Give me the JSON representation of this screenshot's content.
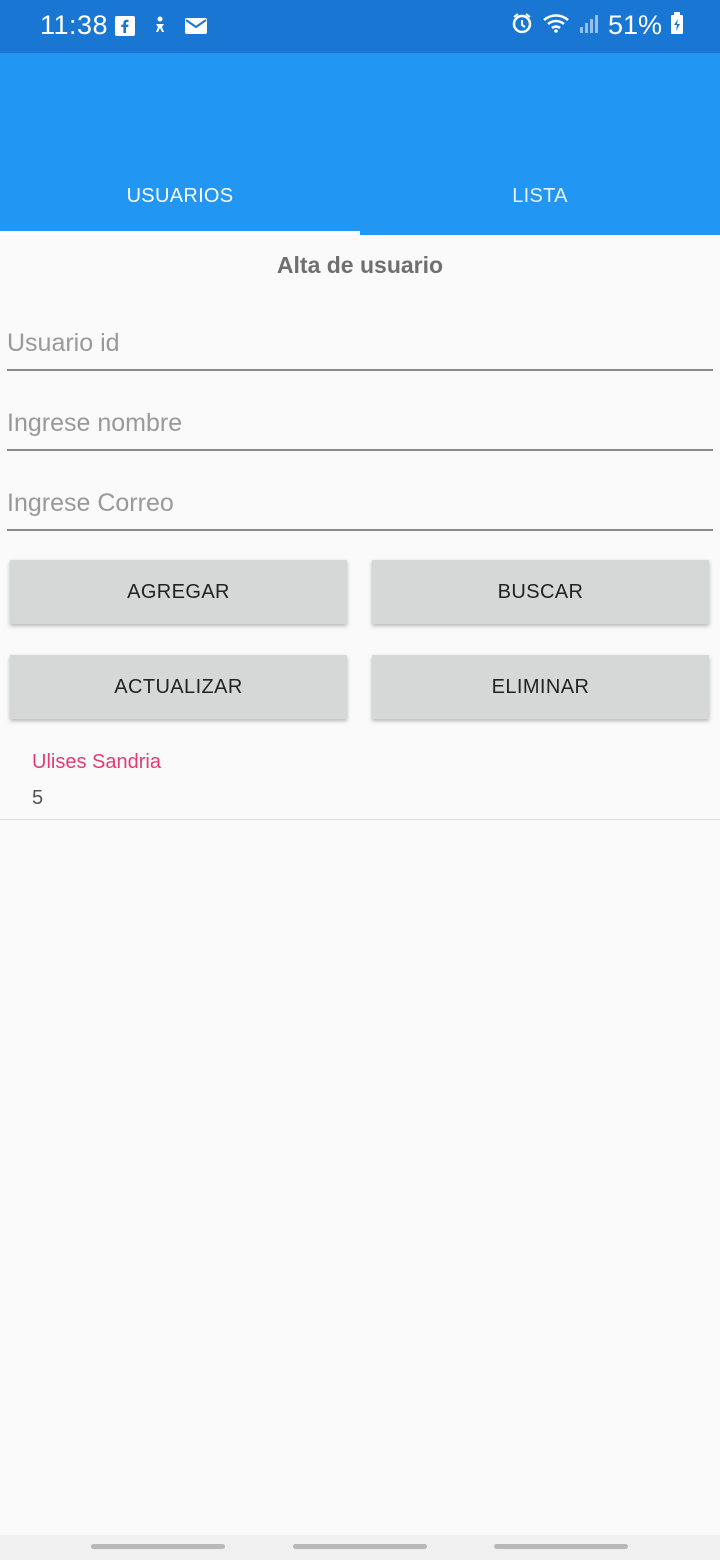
{
  "status_bar": {
    "time": "11:38",
    "battery": "51%",
    "left_icons": [
      "facebook-icon",
      "accessibility-icon",
      "mail-icon"
    ],
    "right_icons": [
      "alarm-icon",
      "wifi-icon",
      "signal-icon",
      "battery-icon"
    ]
  },
  "tabs": [
    {
      "label": "USUARIOS",
      "active": true
    },
    {
      "label": "LISTA",
      "active": false
    }
  ],
  "form": {
    "title": "Alta de usuario",
    "fields": [
      {
        "placeholder": "Usuario id",
        "value": ""
      },
      {
        "placeholder": "Ingrese nombre",
        "value": ""
      },
      {
        "placeholder": "Ingrese Correo",
        "value": ""
      }
    ],
    "buttons": {
      "add": "AGREGAR",
      "search": "BUSCAR",
      "update": "ACTUALIZAR",
      "delete": "ELIMINAR"
    }
  },
  "list": {
    "items": [
      {
        "name": "Ulises Sandria",
        "id": "5"
      }
    ]
  },
  "colors": {
    "status_bar": "#1976d2",
    "app_bar": "#2196f3",
    "accent_text": "#e23b73",
    "button_bg": "#d6d7d7"
  }
}
